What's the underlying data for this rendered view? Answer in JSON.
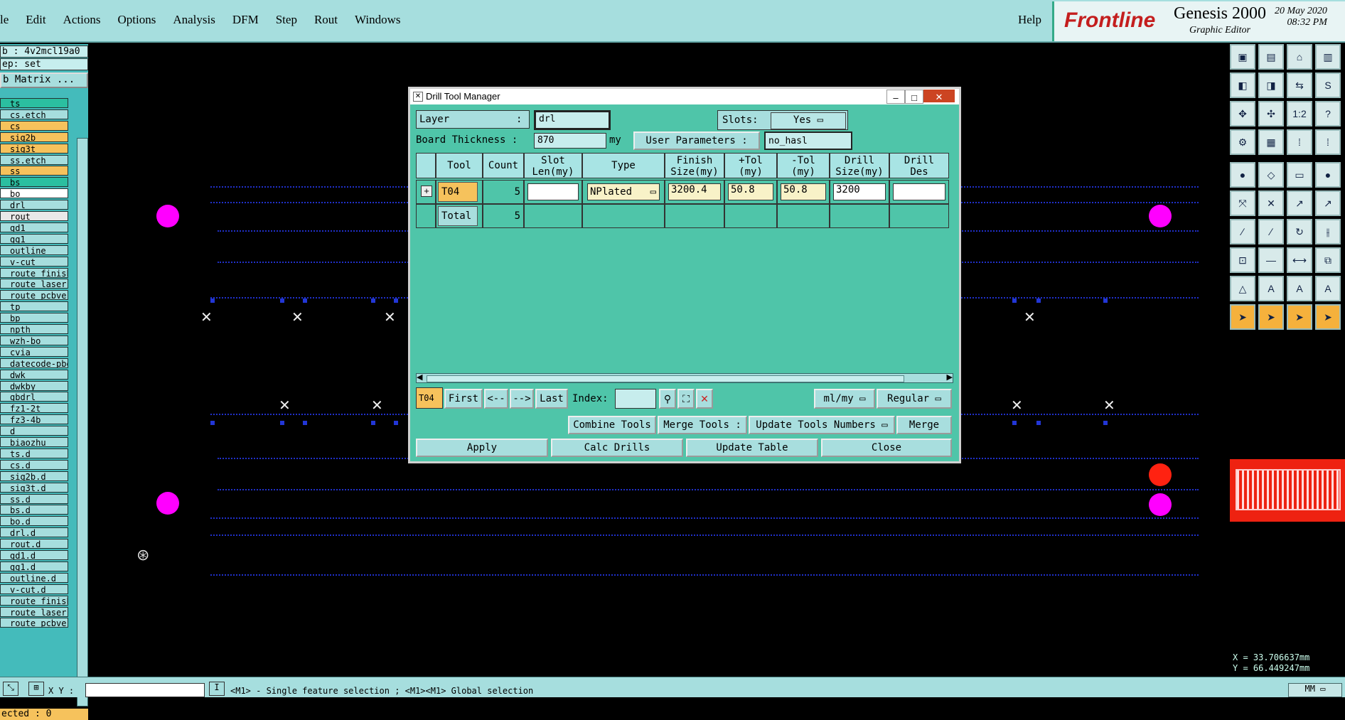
{
  "menubar": {
    "items": [
      "le",
      "Edit",
      "Actions",
      "Options",
      "Analysis",
      "DFM",
      "Step",
      "Rout",
      "Windows"
    ],
    "help": "Help",
    "logo": "Frontline",
    "product": "Genesis 2000",
    "subtitle": "Graphic Editor",
    "date": "20 May 2020",
    "time": "08:32 PM"
  },
  "left_panel": {
    "job": "b : 4v2mcl19a0",
    "step": "ep: set",
    "matrix_button": "b Matrix ...",
    "layers": [
      {
        "name": "ts",
        "color": "#2bbfa0"
      },
      {
        "name": "cs.etch",
        "color": "#a6dede"
      },
      {
        "name": "cs",
        "color": "#f6c25c"
      },
      {
        "name": "sig2b",
        "color": "#f6c25c"
      },
      {
        "name": "sig3t",
        "color": "#f6c25c"
      },
      {
        "name": "ss.etch",
        "color": "#a6dede"
      },
      {
        "name": "ss",
        "color": "#f6c25c"
      },
      {
        "name": "bs",
        "color": "#2bbfa0"
      },
      {
        "name": "bo",
        "color": "#ffffff"
      },
      {
        "name": "drl",
        "color": "#a6dede"
      },
      {
        "name": "rout",
        "color": "#e8e8e8"
      },
      {
        "name": "gd1",
        "color": "#a6dede"
      },
      {
        "name": "gg1",
        "color": "#a6dede"
      },
      {
        "name": "outline",
        "color": "#a6dede"
      },
      {
        "name": "v-cut",
        "color": "#a6dede"
      },
      {
        "name": "route_finish",
        "color": "#a6dede"
      },
      {
        "name": "route_laser",
        "color": "#a6dede"
      },
      {
        "name": "route_pcbver",
        "color": "#a6dede"
      },
      {
        "name": "tp",
        "color": "#a6dede"
      },
      {
        "name": "bp",
        "color": "#a6dede"
      },
      {
        "name": "npth",
        "color": "#a6dede"
      },
      {
        "name": "wzh-bo",
        "color": "#a6dede"
      },
      {
        "name": "cvia",
        "color": "#a6dede"
      },
      {
        "name": "datecode-pbe",
        "color": "#a6dede"
      },
      {
        "name": "dwk",
        "color": "#a6dede"
      },
      {
        "name": "dwkby",
        "color": "#a6dede"
      },
      {
        "name": "gbdrl",
        "color": "#a6dede"
      },
      {
        "name": "fz1-2t",
        "color": "#a6dede"
      },
      {
        "name": "fz3-4b",
        "color": "#a6dede"
      },
      {
        "name": "d",
        "color": "#a6dede"
      },
      {
        "name": "biaozhu",
        "color": "#a6dede"
      },
      {
        "name": "ts.d",
        "color": "#a6dede"
      },
      {
        "name": "cs.d",
        "color": "#a6dede"
      },
      {
        "name": "sig2b.d",
        "color": "#a6dede"
      },
      {
        "name": "sig3t.d",
        "color": "#a6dede"
      },
      {
        "name": "ss.d",
        "color": "#a6dede"
      },
      {
        "name": "bs.d",
        "color": "#a6dede"
      },
      {
        "name": "bo.d",
        "color": "#a6dede"
      },
      {
        "name": "drl.d",
        "color": "#a6dede"
      },
      {
        "name": "rout.d",
        "color": "#a6dede"
      },
      {
        "name": "gd1.d",
        "color": "#a6dede"
      },
      {
        "name": "gg1.d",
        "color": "#a6dede"
      },
      {
        "name": "outline.d",
        "color": "#a6dede"
      },
      {
        "name": "v-cut.d",
        "color": "#a6dede"
      },
      {
        "name": "route_finish",
        "color": "#a6dede"
      },
      {
        "name": "route_laser",
        "color": "#a6dede"
      },
      {
        "name": "route_pcbver",
        "color": "#a6dede"
      }
    ],
    "selected": "ected : 0"
  },
  "dialog": {
    "title": "Drill Tool Manager",
    "layer_label": "Layer",
    "layer_colon": ":",
    "layer_value": "drl",
    "slots_label": "Slots:",
    "slots_value": "Yes",
    "thickness_label": "Board Thickness :",
    "thickness_value": "870",
    "thickness_unit": "my",
    "user_params_label": "User Parameters :",
    "user_params_value": "no_hasl",
    "columns": [
      "Tool",
      "Count",
      "Slot Len(my)",
      "Type",
      "Finish Size(my)",
      "+Tol (my)",
      "-Tol (my)",
      "Drill Size(my)",
      "Drill Des"
    ],
    "row": {
      "tool": "T04",
      "count": "5",
      "type": "NPlated",
      "finish": "3200.4",
      "ptol": "50.8",
      "mtol": "50.8",
      "drill": "3200"
    },
    "total_label": "Total",
    "total_count": "5",
    "nav": {
      "current": "T04",
      "first": "First",
      "prev": "<--",
      "next": "-->",
      "last": "Last",
      "index": "Index:",
      "units": "ml/my",
      "mode": "Regular"
    },
    "combine": "Combine Tools",
    "merge_tools": "Merge Tools :",
    "update_numbers": "Update Tools Numbers",
    "merge": "Merge",
    "apply": "Apply",
    "calc": "Calc Drills",
    "update_table": "Update Table",
    "close": "Close"
  },
  "status": {
    "xy_label": "X Y :",
    "message": "<M1> - Single feature selection ; <M1><M1> Global selection",
    "units": "MM"
  },
  "coords": {
    "x": "X = 33.706637mm",
    "y": "Y = 66.449247mm"
  }
}
